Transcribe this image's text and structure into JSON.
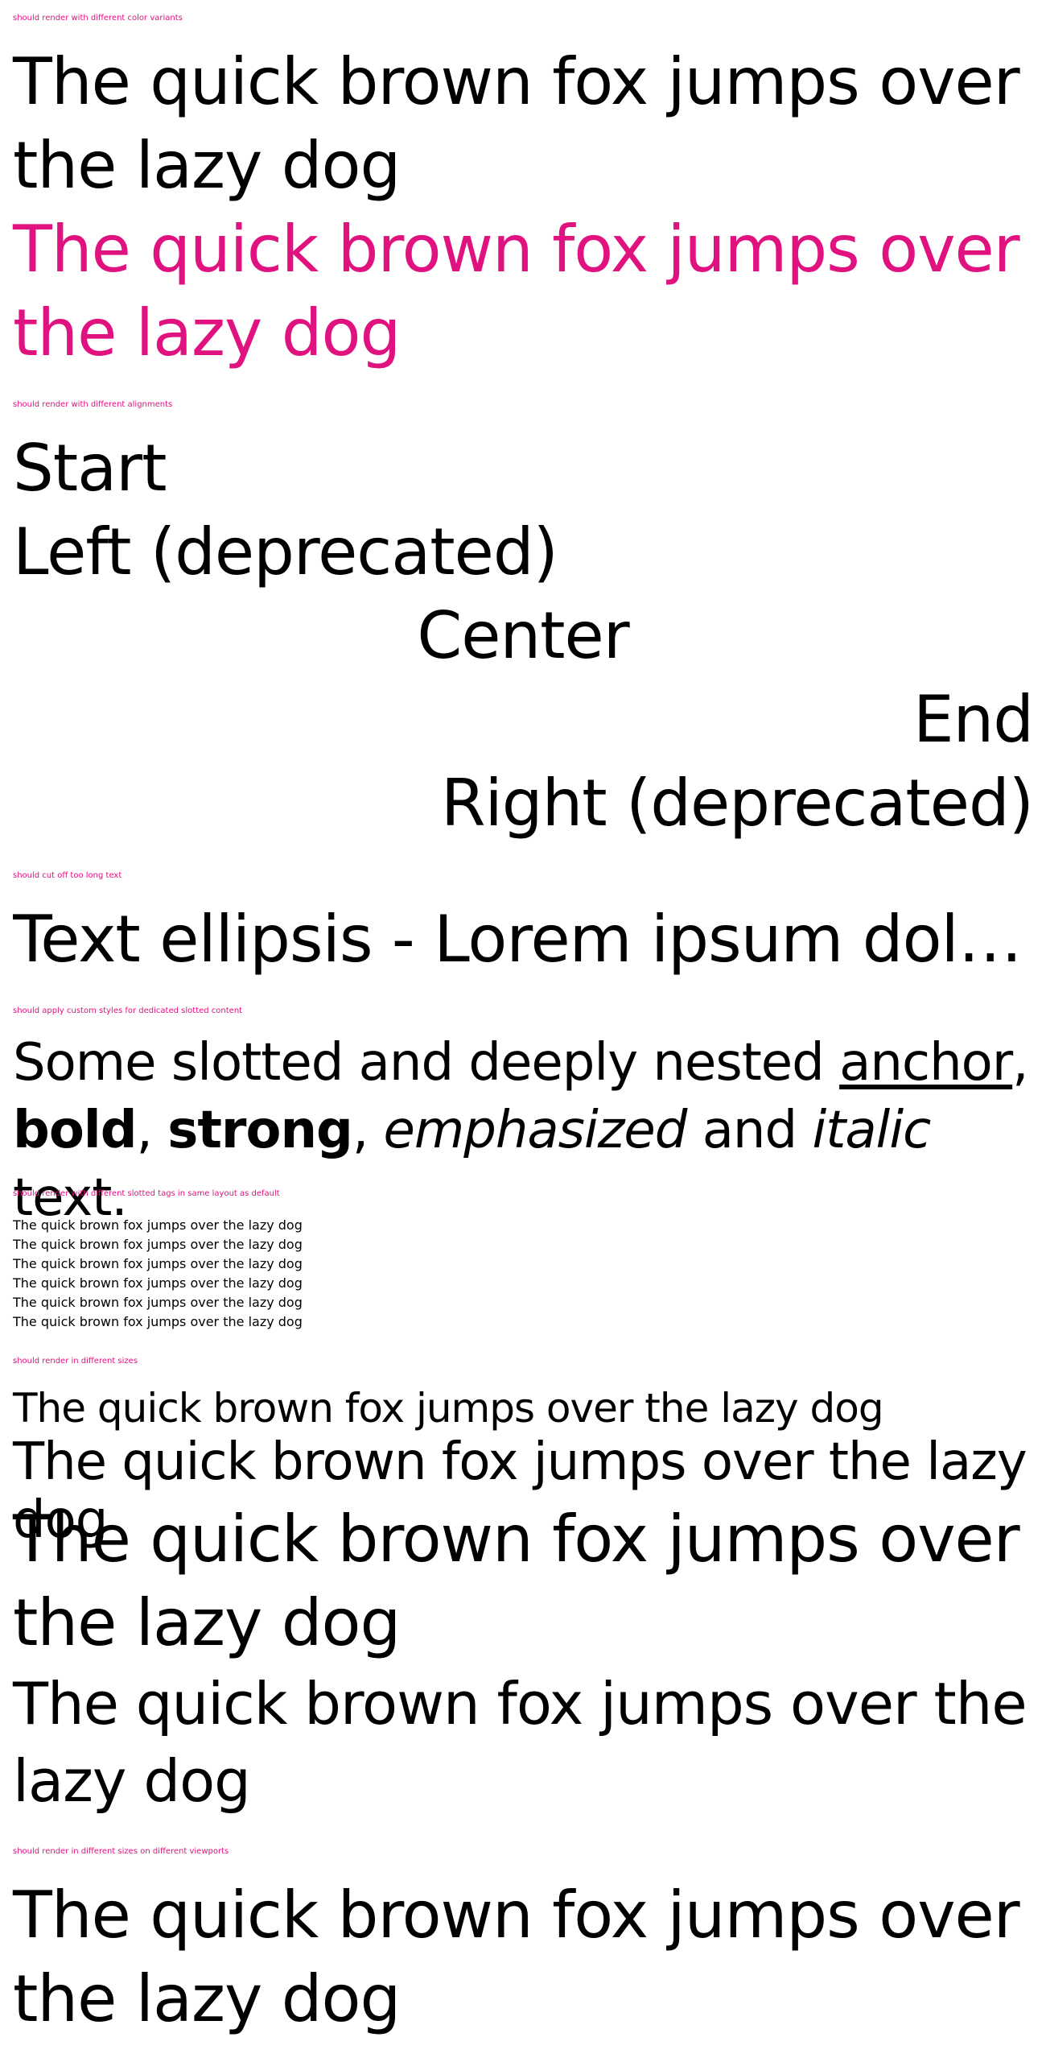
{
  "sections": {
    "color": {
      "label": "should render with different color variants",
      "text_default": "The quick brown fox jumps over the lazy dog",
      "text_accent": "The quick brown fox jumps over the lazy dog"
    },
    "align": {
      "label": "should render with different alignments",
      "start": "Start",
      "left": "Left (deprecated)",
      "center": "Center",
      "end": "End",
      "right": "Right (deprecated)"
    },
    "ellipsis": {
      "label": "should cut off too long text",
      "text": "Text ellipsis - Lorem ipsum dolor sit amet, consetetur sadipscing elitr, sed diam nonumy eirmod tempor"
    },
    "slotted": {
      "label": "should apply custom styles for dedicated slotted content",
      "part1": "Some slotted and deeply nested ",
      "anchor": "anchor",
      "sep1": ",",
      "bold": "bold",
      "sep2": ", ",
      "strong": "strong",
      "sep3": ", ",
      "emphasized": "emphasized",
      "and": " and ",
      "italic": "italic",
      "end": " text."
    },
    "tags": {
      "label": "should render with different slotted tags in same layout as default",
      "lines": [
        "The quick brown fox jumps over the lazy dog",
        "The quick brown fox jumps over the lazy dog",
        "The quick brown fox jumps over the lazy dog",
        "The quick brown fox jumps over the lazy dog",
        "The quick brown fox jumps over the lazy dog",
        "The quick brown fox jumps over the lazy dog"
      ]
    },
    "sizes": {
      "label": "should render in different sizes",
      "line1": "The quick brown fox jumps over the lazy dog",
      "line2": "The quick brown fox jumps over the lazy dog",
      "line3": "The quick brown fox jumps over the lazy dog",
      "line4": "The quick brown fox jumps over the lazy dog"
    },
    "viewports": {
      "label": "should render in different sizes on different viewports",
      "text": "The quick brown fox jumps over the lazy dog"
    }
  },
  "colors": {
    "accent": "#e0127f",
    "default": "#000000",
    "background": "#ffffff"
  }
}
